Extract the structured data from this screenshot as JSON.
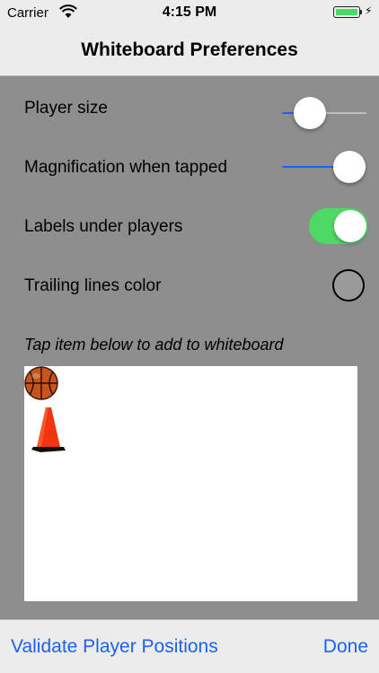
{
  "status_bar": {
    "carrier": "Carrier",
    "time": "4:15 PM",
    "battery_level": 1.0,
    "battery_color": "#4cd964",
    "wifi_icon": "wifi-icon",
    "charging_icon": "bolt-icon"
  },
  "nav": {
    "title": "Whiteboard Preferences"
  },
  "settings": {
    "player_size": {
      "label": "Player size",
      "value": 0.33
    },
    "magnification": {
      "label": "Magnification when tapped",
      "value": 0.8
    },
    "labels_under_players": {
      "label": "Labels under players",
      "on": true
    },
    "trailing_lines_color": {
      "label": "Trailing lines color",
      "color": "#9a9a9a"
    }
  },
  "palette": {
    "hint": "Tap item below to add to whiteboard",
    "items": [
      "basketball-icon",
      "traffic-cone-icon"
    ]
  },
  "toolbar": {
    "validate_label": "Validate Player Positions",
    "done_label": "Done"
  },
  "colors": {
    "accent": "#1a62f5",
    "toggle_on": "#4cd964",
    "background": "#8e8e8e",
    "bar": "#ececec"
  }
}
